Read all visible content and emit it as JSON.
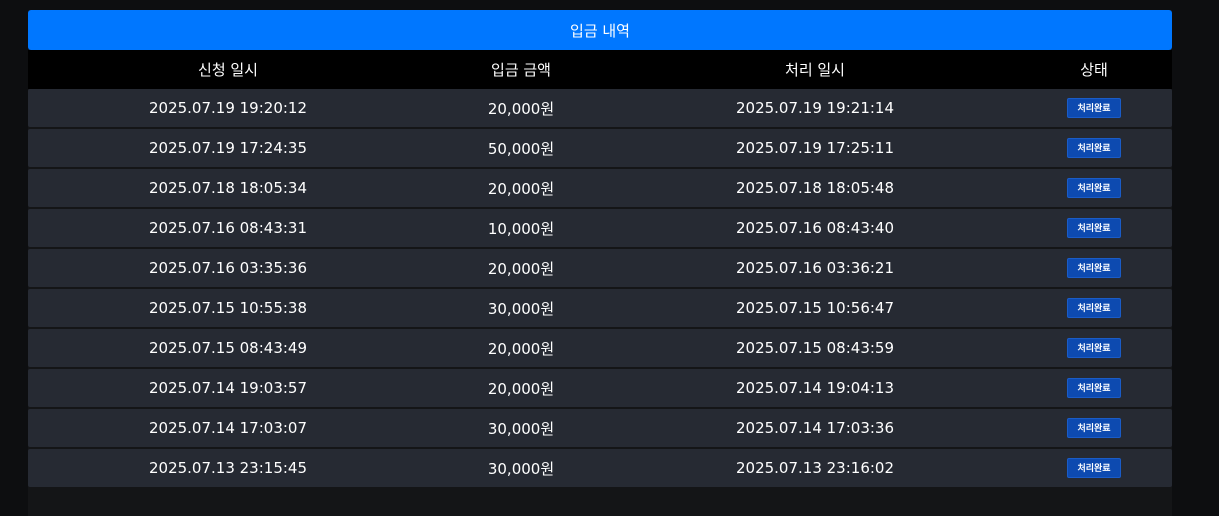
{
  "title": "입금 내역",
  "columns": [
    "신청 일시",
    "입금 금액",
    "처리 일시",
    "상태"
  ],
  "rows": [
    {
      "requested": "2025.07.19 19:20:12",
      "amount": "20,000원",
      "processed": "2025.07.19 19:21:14",
      "status": "처리완료"
    },
    {
      "requested": "2025.07.19 17:24:35",
      "amount": "50,000원",
      "processed": "2025.07.19 17:25:11",
      "status": "처리완료"
    },
    {
      "requested": "2025.07.18 18:05:34",
      "amount": "20,000원",
      "processed": "2025.07.18 18:05:48",
      "status": "처리완료"
    },
    {
      "requested": "2025.07.16 08:43:31",
      "amount": "10,000원",
      "processed": "2025.07.16 08:43:40",
      "status": "처리완료"
    },
    {
      "requested": "2025.07.16 03:35:36",
      "amount": "20,000원",
      "processed": "2025.07.16 03:36:21",
      "status": "처리완료"
    },
    {
      "requested": "2025.07.15 10:55:38",
      "amount": "30,000원",
      "processed": "2025.07.15 10:56:47",
      "status": "처리완료"
    },
    {
      "requested": "2025.07.15 08:43:49",
      "amount": "20,000원",
      "processed": "2025.07.15 08:43:59",
      "status": "처리완료"
    },
    {
      "requested": "2025.07.14 19:03:57",
      "amount": "20,000원",
      "processed": "2025.07.14 19:04:13",
      "status": "처리완료"
    },
    {
      "requested": "2025.07.14 17:03:07",
      "amount": "30,000원",
      "processed": "2025.07.14 17:03:36",
      "status": "처리완료"
    },
    {
      "requested": "2025.07.13 23:15:45",
      "amount": "30,000원",
      "processed": "2025.07.13 23:16:02",
      "status": "처리완료"
    }
  ],
  "colors": {
    "title_bg": "#0077ff",
    "header_bg": "#000000",
    "row_bg": "#262a33",
    "badge_bg": "#0d4ab0",
    "page_bg": "#0d0e10"
  }
}
